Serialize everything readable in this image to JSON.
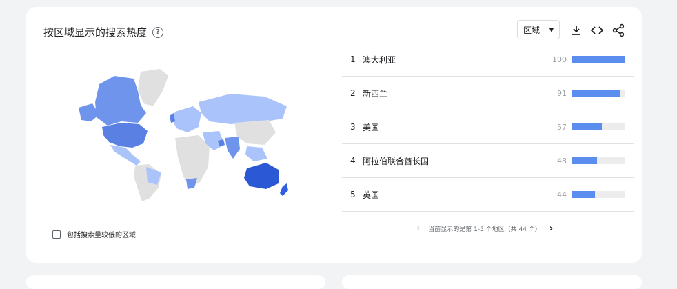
{
  "card": {
    "title": "按区域显示的搜索热度",
    "help_icon": "?"
  },
  "toolbar": {
    "region_select_value": "区域",
    "download_icon": "download-icon",
    "embed_icon": "embed-code-icon",
    "share_icon": "share-icon"
  },
  "ranking": [
    {
      "rank": "1",
      "name": "澳大利亚",
      "value": "100",
      "fill": 100
    },
    {
      "rank": "2",
      "name": "新西兰",
      "value": "91",
      "fill": 91
    },
    {
      "rank": "3",
      "name": "美国",
      "value": "57",
      "fill": 57
    },
    {
      "rank": "4",
      "name": "阿拉伯联合酋长国",
      "value": "48",
      "fill": 48
    },
    {
      "rank": "5",
      "name": "英国",
      "value": "44",
      "fill": 44
    }
  ],
  "pager": {
    "text": "当前显示的是第 1-5 个地区（共 44 个）",
    "prev_icon": "chevron-left-icon",
    "next_icon": "chevron-right-icon"
  },
  "checkbox": {
    "label": "包括搜索量较低的区域",
    "checked": false
  },
  "colors": {
    "bar": "#5b8def",
    "high": "#2b59d6",
    "medium": "#6f94ec",
    "low": "#aac4fb",
    "none": "#e0e0e0"
  }
}
